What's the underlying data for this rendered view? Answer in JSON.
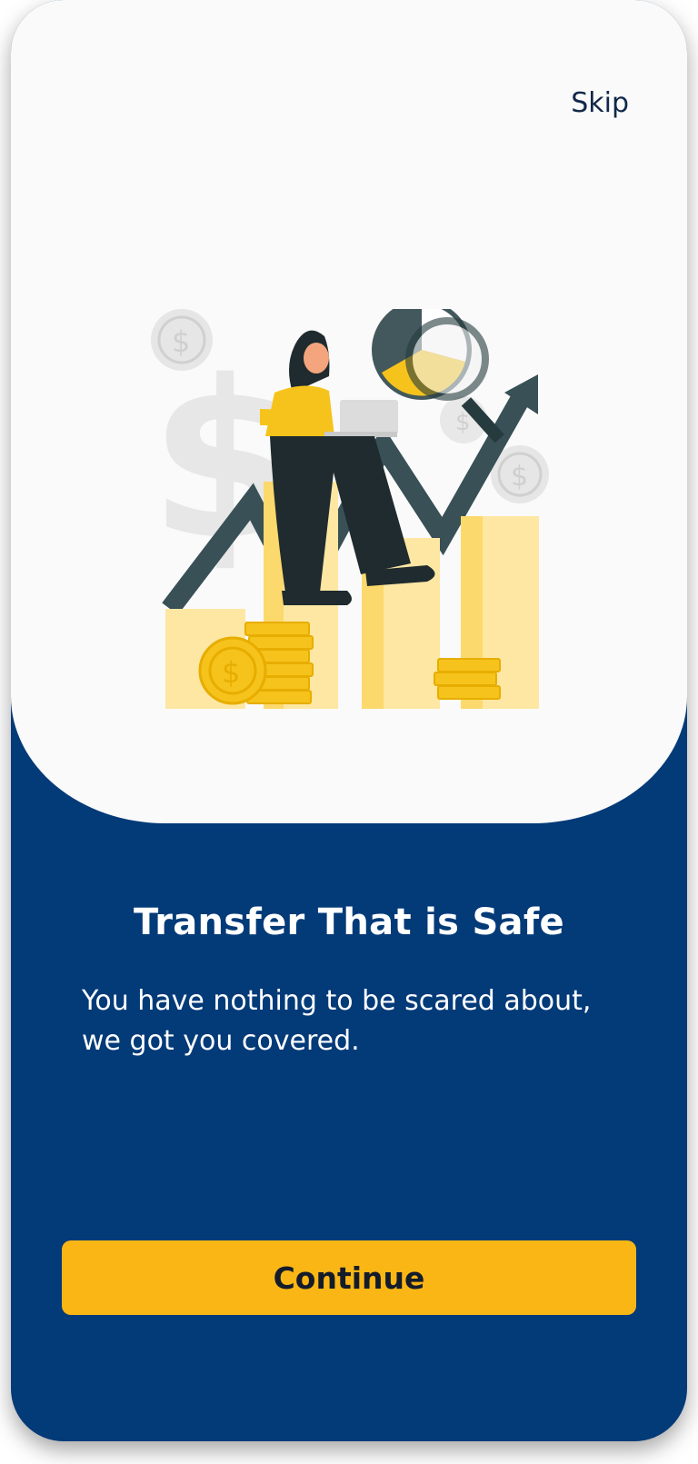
{
  "onboarding": {
    "skip_label": "Skip",
    "title": "Transfer That is Safe",
    "description": "You have nothing to be scared about, we got you covered.",
    "continue_label": "Continue",
    "illustration_icon": "woman-with-laptop-on-bar-chart-illustration"
  },
  "colors": {
    "background_dark": "#033a78",
    "card_light": "#fafafa",
    "accent_yellow": "#f9b615",
    "text_dark": "#141c2b"
  }
}
